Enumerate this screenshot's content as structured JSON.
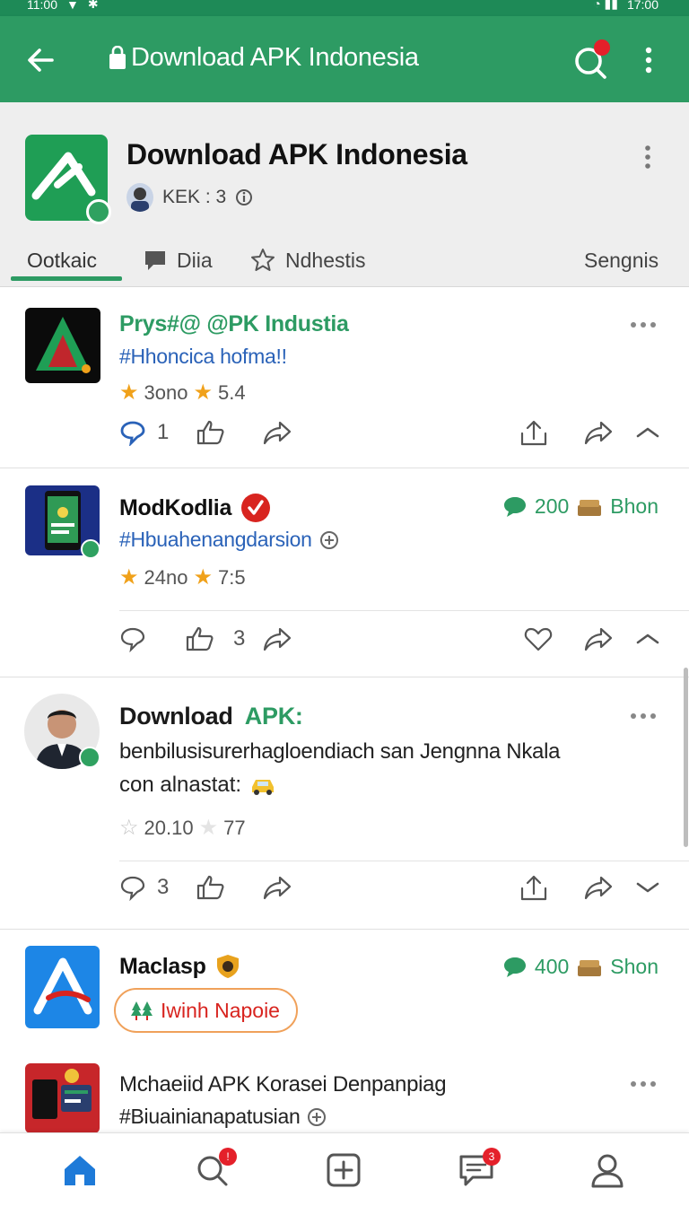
{
  "status_bar": {
    "left_text": "11:00",
    "right_text": "17:00"
  },
  "app_bar": {
    "title": "Download APK Indonesia"
  },
  "channel": {
    "name": "Download APK Indonesia",
    "meta": "KEK : 3",
    "tabs": [
      {
        "label": "Ootkaic"
      },
      {
        "label": "Diia"
      },
      {
        "label": "Ndhestis"
      },
      {
        "label": "Sengnis"
      }
    ]
  },
  "posts": [
    {
      "title": "Prys#@ @PK Industia",
      "tag": "#Hhoncica hofma!!",
      "rating_a": "3ono",
      "rating_b": "5.4",
      "comments": "1"
    },
    {
      "title": "ModKodlia",
      "tag": "#Hbuahenangdarsion",
      "rating_a": "24no",
      "rating_b": "7:5",
      "stat_count": "200",
      "stat_label": "Bhon",
      "likes": "3"
    },
    {
      "title_black": "Download",
      "title_green": "APK:",
      "body_line1": "benbilusisurerhagloendiach san Jengnna Nkala",
      "body_line2": "con alnastat:",
      "rating_a": "20.10",
      "rating_b": "77",
      "comments": "3"
    },
    {
      "title": "Maclasp",
      "chip": "Iwinh Napoie",
      "stat_count": "400",
      "stat_label": "Shon"
    },
    {
      "title": "Mchaeiid APK Korasei Denpanpiag",
      "tag": "#Biuainianapatusian"
    }
  ],
  "bottom_nav": {
    "search_badge": "!",
    "messages_badge": "3"
  },
  "colors": {
    "brand_green": "#2d9b63",
    "link_blue": "#2a62b8",
    "star": "#f0a11a",
    "badge_red": "#e4202a"
  }
}
